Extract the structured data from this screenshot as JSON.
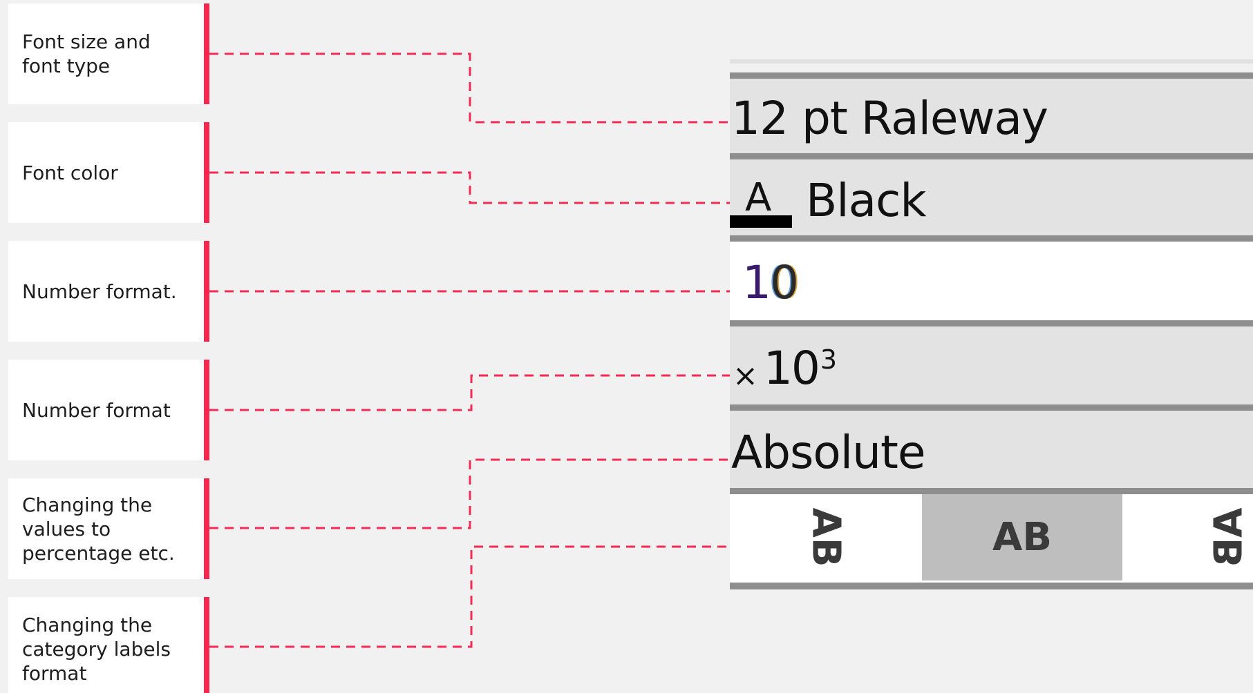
{
  "callouts": [
    {
      "label": "Font size and\nfont type"
    },
    {
      "label": "Font color"
    },
    {
      "label": "Number format."
    },
    {
      "label": "Number format"
    },
    {
      "label": "Changing the\nvalues to\npercentage etc."
    },
    {
      "label": "Changing the\ncategory labels\nformat"
    }
  ],
  "toolbar": {
    "font": {
      "value": "12 pt Raleway"
    },
    "color": {
      "glyph": "A",
      "value": "Black",
      "swatch": "#000000"
    },
    "number": {
      "digit1": "1",
      "digit2": "0"
    },
    "scale": {
      "x": "×",
      "base": "10",
      "exponent": "3"
    },
    "mode": {
      "value": "Absolute"
    },
    "orientation": {
      "options": [
        {
          "label": "AB",
          "icon": "text-rotated-icon"
        },
        {
          "label": "AB",
          "icon": "text-horizontal-icon",
          "selected": true
        },
        {
          "label": "AB",
          "icon": "text-rotated-icon"
        }
      ]
    }
  },
  "colors": {
    "accent": "#fb2650",
    "connector": "#f22c55",
    "panel_bg": "#e3e3e3",
    "selected_bg": "#bebebe"
  }
}
